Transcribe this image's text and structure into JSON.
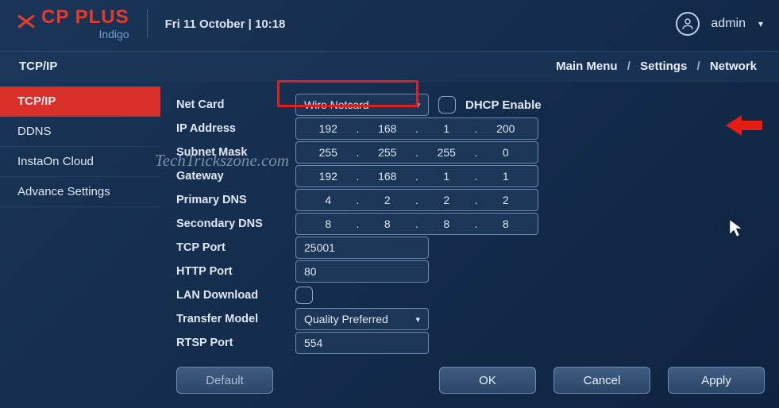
{
  "header": {
    "brand1": "CP PLUS",
    "brand2": "Indigo",
    "datetime": "Fri 11 October | 10:18",
    "username": "admin"
  },
  "topbar": {
    "page": "TCP/IP",
    "crumb1": "Main Menu",
    "crumb2": "Settings",
    "crumb3": "Network"
  },
  "sidebar": {
    "items": [
      "TCP/IP",
      "DDNS",
      "InstaOn Cloud",
      "Advance Settings"
    ]
  },
  "labels": {
    "netcard": "Net Card",
    "ip": "IP Address",
    "subnet": "Subnet Mask",
    "gateway": "Gateway",
    "pdns": "Primary DNS",
    "sdns": "Secondary DNS",
    "tcpport": "TCP Port",
    "httpport": "HTTP Port",
    "landl": "LAN Download",
    "transfer": "Transfer Model",
    "rtsp": "RTSP Port",
    "dhcp": "DHCP Enable"
  },
  "values": {
    "netcard": "Wire Netcard",
    "ip": [
      "192",
      "168",
      "1",
      "200"
    ],
    "subnet": [
      "255",
      "255",
      "255",
      "0"
    ],
    "gateway": [
      "192",
      "168",
      "1",
      "1"
    ],
    "pdns": [
      "4",
      "2",
      "2",
      "2"
    ],
    "sdns": [
      "8",
      "8",
      "8",
      "8"
    ],
    "tcpport": "25001",
    "httpport": "80",
    "transfer": "Quality Preferred",
    "rtsp": "554"
  },
  "buttons": {
    "default": "Default",
    "ok": "OK",
    "cancel": "Cancel",
    "apply": "Apply"
  },
  "watermark": "TechTrickszone.com"
}
